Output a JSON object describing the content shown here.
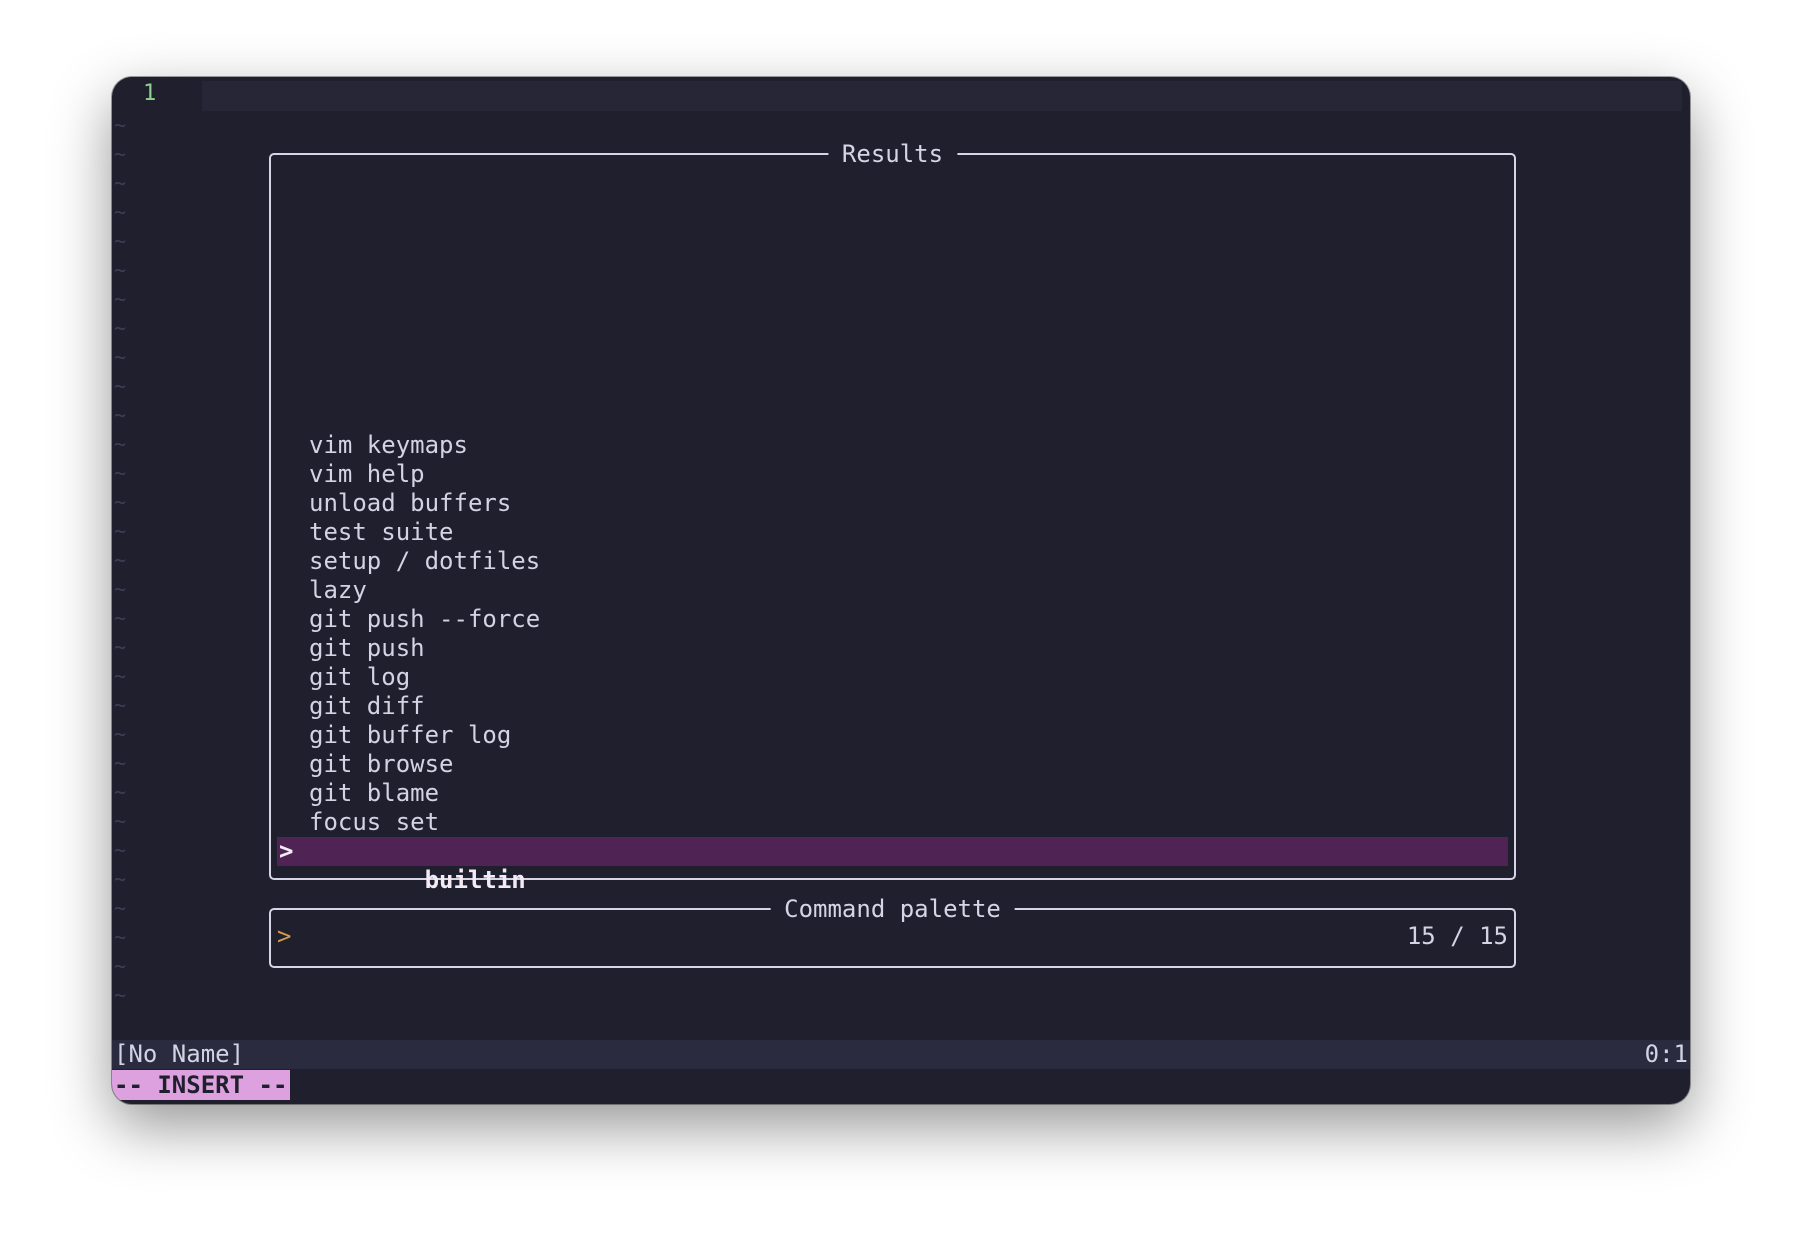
{
  "editor": {
    "line_number": "1",
    "empty_line_marker": "~"
  },
  "results": {
    "title": "Results",
    "items": [
      "vim keymaps",
      "vim help",
      "unload buffers",
      "test suite",
      "setup / dotfiles",
      "lazy",
      "git push --force",
      "git push",
      "git log",
      "git diff",
      "git buffer log",
      "git browse",
      "git blame",
      "focus set"
    ],
    "selected": {
      "caret": ">",
      "label": "builtin"
    }
  },
  "palette": {
    "title": "Command palette",
    "prompt_caret": ">",
    "query": "",
    "count": "15 / 15"
  },
  "statusline": {
    "filename": "[No Name]",
    "position": "0:1"
  },
  "mode": {
    "label": "-- INSERT --"
  },
  "colors": {
    "background": "#1f1f2e",
    "selection": "#4f2353",
    "mode_badge": "#dda1df",
    "line_number": "#8fd18f",
    "prompt_caret": "#d39a4a"
  }
}
